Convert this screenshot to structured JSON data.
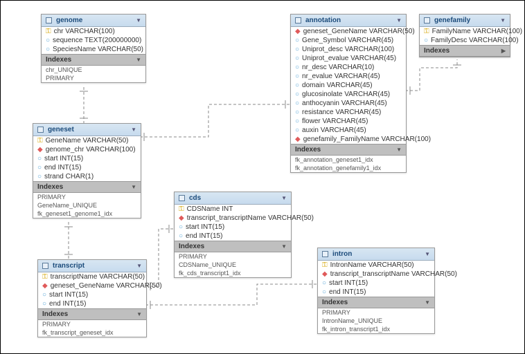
{
  "entities": {
    "genome": {
      "title": "genome",
      "columns": [
        {
          "icon": "pk",
          "text": "chr VARCHAR(100)"
        },
        {
          "icon": "col",
          "text": "sequence TEXT(200000000)"
        },
        {
          "icon": "col",
          "text": "SpeciesName VARCHAR(50)"
        }
      ],
      "idx_label": "Indexes",
      "indexes": [
        "chr_UNIQUE",
        "PRIMARY"
      ]
    },
    "geneset": {
      "title": "geneset",
      "columns": [
        {
          "icon": "pk",
          "text": "GeneName VARCHAR(50)"
        },
        {
          "icon": "fk",
          "text": "genome_chr VARCHAR(100)"
        },
        {
          "icon": "col",
          "text": "start INT(15)"
        },
        {
          "icon": "col",
          "text": "end INT(15)"
        },
        {
          "icon": "col",
          "text": "strand CHAR(1)"
        }
      ],
      "idx_label": "Indexes",
      "indexes": [
        "PRIMARY",
        "GeneName_UNIQUE",
        "fk_geneset1_genome1_idx"
      ]
    },
    "transcript": {
      "title": "transcript",
      "columns": [
        {
          "icon": "pk",
          "text": "transcriptName VARCHAR(50)"
        },
        {
          "icon": "fk",
          "text": "geneset_GeneName VARCHAR(50)"
        },
        {
          "icon": "col",
          "text": "start INT(15)"
        },
        {
          "icon": "col",
          "text": "end INT(15)"
        }
      ],
      "idx_label": "Indexes",
      "indexes": [
        "PRIMARY",
        "fk_transcript_geneset_idx"
      ]
    },
    "cds": {
      "title": "cds",
      "columns": [
        {
          "icon": "pk",
          "text": "CDSName INT"
        },
        {
          "icon": "fk",
          "text": "transcript_transcriptName VARCHAR(50)"
        },
        {
          "icon": "col",
          "text": "start INT(15)"
        },
        {
          "icon": "col",
          "text": "end INT(15)"
        }
      ],
      "idx_label": "Indexes",
      "indexes": [
        "PRIMARY",
        "CDSName_UNIQUE",
        "fk_cds_transcript1_idx"
      ]
    },
    "annotation": {
      "title": "annotation",
      "columns": [
        {
          "icon": "fk",
          "text": "geneset_GeneName VARCHAR(50)"
        },
        {
          "icon": "col",
          "text": "Gene_Symbol VARCHAR(45)"
        },
        {
          "icon": "col",
          "text": "Uniprot_desc VARCHAR(100)"
        },
        {
          "icon": "col",
          "text": "Uniprot_evalue VARCHAR(45)"
        },
        {
          "icon": "col",
          "text": "nr_desc VARCHAR(10)"
        },
        {
          "icon": "col",
          "text": "nr_evalue VARCHAR(45)"
        },
        {
          "icon": "col",
          "text": "domain VARCHAR(45)"
        },
        {
          "icon": "col",
          "text": "glucosinolate VARCHAR(45)"
        },
        {
          "icon": "col",
          "text": "anthocyanin VARCHAR(45)"
        },
        {
          "icon": "col",
          "text": "resistance VARCHAR(45)"
        },
        {
          "icon": "col",
          "text": "flower VARCHAR(45)"
        },
        {
          "icon": "col",
          "text": "auxin VARCHAR(45)"
        },
        {
          "icon": "fk",
          "text": "genefamily_FamilyName VARCHAR(100)"
        }
      ],
      "idx_label": "Indexes",
      "indexes": [
        "fk_annotation_geneset1_idx",
        "fk_annotation_genefamily1_idx"
      ]
    },
    "genefamily": {
      "title": "genefamily",
      "columns": [
        {
          "icon": "pk",
          "text": "FamilyName VARCHAR(100)"
        },
        {
          "icon": "col",
          "text": "FamilyDesc VARCHAR(100)"
        }
      ],
      "idx_label": "Indexes",
      "indexes": []
    },
    "intron": {
      "title": "intron",
      "columns": [
        {
          "icon": "pk",
          "text": "IntronName VARCHAR(50)"
        },
        {
          "icon": "fk",
          "text": "transcript_transcriptName VARCHAR(50)"
        },
        {
          "icon": "col",
          "text": "start INT(15)"
        },
        {
          "icon": "col",
          "text": "end INT(15)"
        }
      ],
      "idx_label": "Indexes",
      "indexes": [
        "PRIMARY",
        "IntronName_UNIQUE",
        "fk_intron_transcript1_idx"
      ]
    }
  }
}
